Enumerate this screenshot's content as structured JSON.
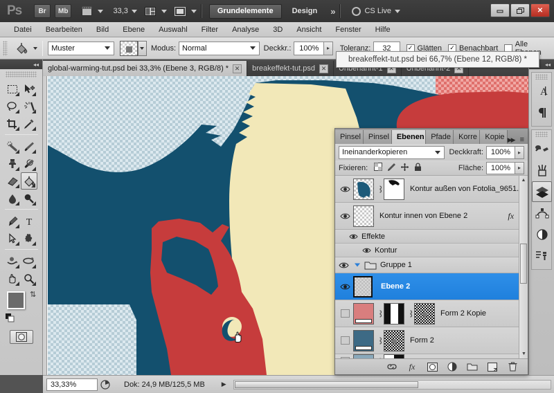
{
  "titlebar": {
    "logo": "Ps",
    "bridge_label": "Br",
    "minibridge_label": "Mb",
    "zoom_value": "33,3",
    "workspace_active": "Grundelemente",
    "workspace_design": "Design",
    "workspace_more": "»",
    "cslive_label": "CS Live",
    "minimize": "–",
    "restore": "❐",
    "close": "✕"
  },
  "menubar": {
    "items": [
      "Datei",
      "Bearbeiten",
      "Bild",
      "Ebene",
      "Auswahl",
      "Filter",
      "Analyse",
      "3D",
      "Ansicht",
      "Fenster",
      "Hilfe"
    ]
  },
  "optionsbar": {
    "fill_source": "Muster",
    "mode_label": "Modus:",
    "mode_value": "Normal",
    "opacity_label": "Deckkr.:",
    "opacity_value": "100%",
    "tolerance_label": "Toleranz:",
    "tolerance_value": "32",
    "antialias_label": "Glätten",
    "contiguous_label": "Benachbart",
    "alllayers_label": "Alle Ebenen"
  },
  "tooltip": {
    "text": "breakeffekt-tut.psd bei 66,7% (Ebene 12, RGB/8) *"
  },
  "toolbox": {
    "tools": [
      {
        "name": "marquee-tool",
        "glyph": "marquee"
      },
      {
        "name": "move-tool",
        "glyph": "move"
      },
      {
        "name": "lasso-tool",
        "glyph": "lasso"
      },
      {
        "name": "magic-wand-tool",
        "glyph": "wand"
      },
      {
        "name": "crop-tool",
        "glyph": "crop"
      },
      {
        "name": "eyedropper-tool",
        "glyph": "eyedropper"
      },
      {
        "name": "healing-brush-tool",
        "glyph": "heal"
      },
      {
        "name": "brush-tool",
        "glyph": "brush"
      },
      {
        "name": "clone-stamp-tool",
        "glyph": "stamp"
      },
      {
        "name": "history-brush-tool",
        "glyph": "historybrush"
      },
      {
        "name": "eraser-tool",
        "glyph": "eraser"
      },
      {
        "name": "paint-bucket-tool",
        "glyph": "bucket",
        "selected": true
      },
      {
        "name": "blur-tool",
        "glyph": "blur"
      },
      {
        "name": "dodge-tool",
        "glyph": "dodge"
      },
      {
        "name": "pen-tool",
        "glyph": "pen"
      },
      {
        "name": "type-tool",
        "glyph": "type"
      },
      {
        "name": "path-selection-tool",
        "glyph": "pathselect"
      },
      {
        "name": "custom-shape-tool",
        "glyph": "shape"
      },
      {
        "name": "3d-rotate-tool",
        "glyph": "rotate3d"
      },
      {
        "name": "3d-orbit-tool",
        "glyph": "orbit3d"
      },
      {
        "name": "hand-tool",
        "glyph": "hand"
      },
      {
        "name": "zoom-tool",
        "glyph": "zoom"
      }
    ],
    "foreground_color": "#6b6b6b",
    "background_color": "#ffffff"
  },
  "tabs": [
    {
      "label": "global-warming-tut.psd bei 33,3% (Ebene 3, RGB/8) *",
      "active": true,
      "close": "✕"
    },
    {
      "label": "breakeffekt-tut.psd",
      "active": false,
      "close": "✕"
    },
    {
      "label": "Unbenannt-1",
      "active": false,
      "close": "✕"
    },
    {
      "label": "Unbenannt-2",
      "active": false,
      "close": "✕"
    }
  ],
  "tab_overflow": "»",
  "canvas": {
    "colors": {
      "dark_blue": "#13506e",
      "red": "#c63c3c",
      "cream": "#f2e8b8",
      "checker_light": "#dce9ef",
      "checker_dark": "#b6ccd6",
      "checker_red_light": "#f0a8a4",
      "checker_red_dark": "#e0706c"
    }
  },
  "statusbar": {
    "zoom": "33,33%",
    "doc_info": "Dok: 24,9 MB/125,5 MB"
  },
  "layerspanel": {
    "tabs": [
      {
        "label": "Pinsel",
        "active": false
      },
      {
        "label": "Pinsel",
        "active": false
      },
      {
        "label": "Ebenen",
        "active": true
      },
      {
        "label": "Pfade",
        "active": false
      },
      {
        "label": "Korre",
        "active": false
      },
      {
        "label": "Kopie",
        "active": false
      }
    ],
    "collapse_icon": "▶▶",
    "menu_icon": "≡",
    "blend_mode": "Ineinanderkopieren",
    "opacity_label": "Deckkraft:",
    "opacity_value": "100%",
    "lock_label": "Fixieren:",
    "fill_label": "Fläche:",
    "fill_value": "100%",
    "layers": [
      {
        "name": "Kontur außen von Fotolia_9651...",
        "visible": true,
        "selected": false,
        "has_mask": true,
        "thumb_type": "blue-shape",
        "has_fx": false
      },
      {
        "name": "Kontur innen von Ebene 2",
        "visible": true,
        "selected": false,
        "has_mask": false,
        "thumb_type": "checker",
        "has_fx": true
      },
      {
        "name": "Effekte",
        "sub": true,
        "visible": true
      },
      {
        "name": "Kontur",
        "sub": true,
        "sub2": true,
        "visible": true
      },
      {
        "name": "Gruppe 1",
        "group": true,
        "visible": true
      },
      {
        "name": "Ebene 2",
        "visible": true,
        "selected": true,
        "thumb_type": "gray-checker"
      },
      {
        "name": "Form 2 Kopie",
        "visible": false,
        "selected": false,
        "thumb_type": "pink",
        "has_mask": true,
        "has_vector_mask": true
      },
      {
        "name": "Form 2",
        "visible": false,
        "selected": false,
        "thumb_type": "steelblue",
        "has_vector_mask": true
      },
      {
        "name": "",
        "visible": false,
        "selected": false,
        "thumb_type": "lightblue",
        "has_mask": true
      }
    ],
    "footer_buttons": [
      {
        "name": "link-layers-button",
        "glyph": "link"
      },
      {
        "name": "layer-style-button",
        "glyph": "fx"
      },
      {
        "name": "layer-mask-button",
        "glyph": "mask"
      },
      {
        "name": "adjustment-layer-button",
        "glyph": "adjust"
      },
      {
        "name": "new-group-button",
        "glyph": "folder"
      },
      {
        "name": "new-layer-button",
        "glyph": "newlayer"
      },
      {
        "name": "delete-layer-button",
        "glyph": "trash"
      }
    ]
  },
  "rightdock": {
    "groups": [
      {
        "icons": [
          {
            "name": "character-panel-icon",
            "glyph": "A"
          },
          {
            "name": "paragraph-panel-icon",
            "glyph": "¶"
          }
        ]
      },
      {
        "icons": [
          {
            "name": "color-panel-icon",
            "glyph": "color"
          },
          {
            "name": "swatches-panel-icon",
            "glyph": "swatches"
          },
          {
            "name": "layers-panel-icon",
            "glyph": "layers",
            "selected": true
          },
          {
            "name": "paths-panel-icon",
            "glyph": "paths"
          },
          {
            "name": "adjustments-panel-icon",
            "glyph": "adjust"
          },
          {
            "name": "history-panel-icon",
            "glyph": "history"
          }
        ]
      }
    ]
  }
}
